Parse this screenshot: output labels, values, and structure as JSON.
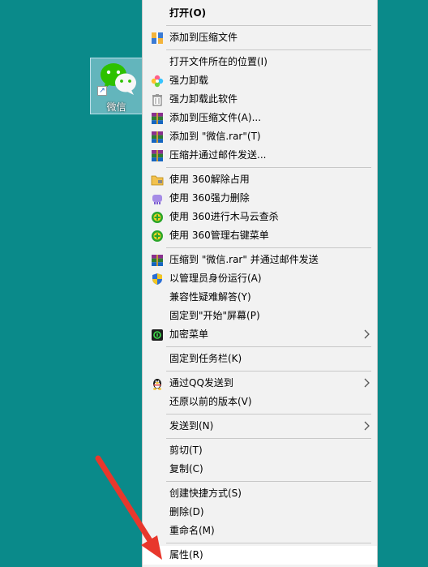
{
  "desktop": {
    "icon_label": "微信",
    "background": "#0a8a8a"
  },
  "menu": {
    "items": [
      {
        "label": "打开(O)",
        "icon": "none",
        "bold": true
      },
      {
        "label": "添加到压缩文件",
        "icon": "archive-blue-icon"
      },
      {
        "label": "打开文件所在的位置(I)",
        "icon": "none"
      },
      {
        "label": "强力卸载",
        "icon": "flower-icon"
      },
      {
        "label": "强力卸载此软件",
        "icon": "trash-icon"
      },
      {
        "label": "添加到压缩文件(A)...",
        "icon": "winrar-icon"
      },
      {
        "label": "添加到 \"微信.rar\"(T)",
        "icon": "winrar-icon"
      },
      {
        "label": "压缩并通过邮件发送...",
        "icon": "winrar-icon"
      },
      {
        "label": "使用 360解除占用",
        "icon": "folder-lock-icon"
      },
      {
        "label": "使用 360强力删除",
        "icon": "purple-shredder-icon"
      },
      {
        "label": "使用 360进行木马云查杀",
        "icon": "360-plus-icon"
      },
      {
        "label": "使用 360管理右键菜单",
        "icon": "360-plus-icon"
      },
      {
        "label": "压缩到 \"微信.rar\" 并通过邮件发送",
        "icon": "winrar-icon"
      },
      {
        "label": "以管理员身份运行(A)",
        "icon": "uac-shield-icon"
      },
      {
        "label": "兼容性疑难解答(Y)",
        "icon": "none"
      },
      {
        "label": "固定到\"开始\"屏幕(P)",
        "icon": "none"
      },
      {
        "label": "加密菜单",
        "icon": "encrypt-icon",
        "submenu": true
      },
      {
        "label": "固定到任务栏(K)",
        "icon": "none"
      },
      {
        "label": "通过QQ发送到",
        "icon": "qq-penguin-icon",
        "submenu": true
      },
      {
        "label": "还原以前的版本(V)",
        "icon": "none"
      },
      {
        "label": "发送到(N)",
        "icon": "none",
        "submenu": true
      },
      {
        "label": "剪切(T)",
        "icon": "none"
      },
      {
        "label": "复制(C)",
        "icon": "none"
      },
      {
        "label": "创建快捷方式(S)",
        "icon": "none"
      },
      {
        "label": "删除(D)",
        "icon": "none"
      },
      {
        "label": "重命名(M)",
        "icon": "none"
      },
      {
        "label": "属性(R)",
        "icon": "none"
      }
    ]
  },
  "colors": {
    "menu_bg": "#f2f2f2",
    "separator": "#c8c8c8",
    "annotation_arrow": "#e8372c"
  }
}
